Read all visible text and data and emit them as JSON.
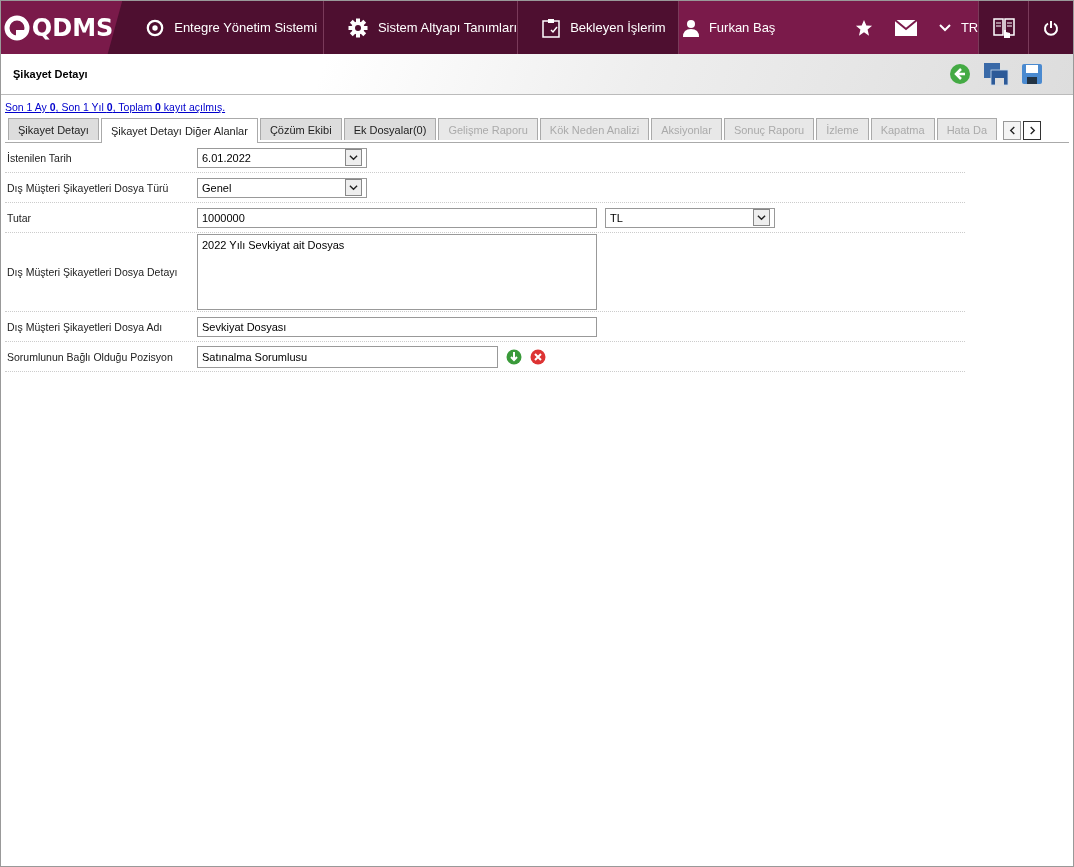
{
  "header": {
    "logo": "QDMS",
    "nav": [
      {
        "kind": "q",
        "label": "Entegre Yönetim Sistemi"
      },
      {
        "kind": "gear",
        "label": "Sistem Altyapı Tanımları"
      },
      {
        "kind": "clipboard",
        "label": "Bekleyen İşlerim"
      },
      {
        "kind": "user",
        "label": "Furkan Baş"
      }
    ],
    "language": "TR"
  },
  "page_title": "Şikayet Detayı",
  "summary_link": "Son 1 Ay **0**, Son 1 Yıl **0**, Toplam **0** kayıt açılmış.",
  "tabs": [
    {
      "label": "Şikayet Detayı",
      "selected": false,
      "disabled": false
    },
    {
      "label": "Şikayet Detayı Diğer Alanlar",
      "selected": true,
      "disabled": false
    },
    {
      "label": "Çözüm Ekibi",
      "selected": false,
      "disabled": false
    },
    {
      "label": "Ek Dosyalar(0)",
      "selected": false,
      "disabled": false
    },
    {
      "label": "Gelişme Raporu",
      "selected": false,
      "disabled": true
    },
    {
      "label": "Kök Neden Analizi",
      "selected": false,
      "disabled": true
    },
    {
      "label": "Aksiyonlar",
      "selected": false,
      "disabled": true
    },
    {
      "label": "Sonuç Raporu",
      "selected": false,
      "disabled": true
    },
    {
      "label": "İzleme",
      "selected": false,
      "disabled": true
    },
    {
      "label": "Kapatma",
      "selected": false,
      "disabled": true
    },
    {
      "label": "Hata Da",
      "selected": false,
      "disabled": true
    }
  ],
  "fields": [
    {
      "kind": "select",
      "label": "İstenilen Tarih",
      "value": "6.01.2022"
    },
    {
      "kind": "select",
      "label": "Dış Müşteri Şikayetleri Dosya Türü",
      "value": "Genel"
    },
    {
      "kind": "amount",
      "label": "Tutar",
      "value": "1000000",
      "currency": "TL"
    },
    {
      "kind": "textarea",
      "label": "Dış Müşteri Şikayetleri Dosya Detayı",
      "value": "2022 Yılı Sevkiyat ait Dosyas"
    },
    {
      "kind": "text",
      "label": "Dış Müşteri Şikayetleri Dosya Adı",
      "value": "Sevkiyat Dosyası"
    },
    {
      "kind": "lookup",
      "label": "Sorumlunun Bağlı Olduğu Pozisyon",
      "value": "Satınalma Sorumlusu"
    }
  ]
}
